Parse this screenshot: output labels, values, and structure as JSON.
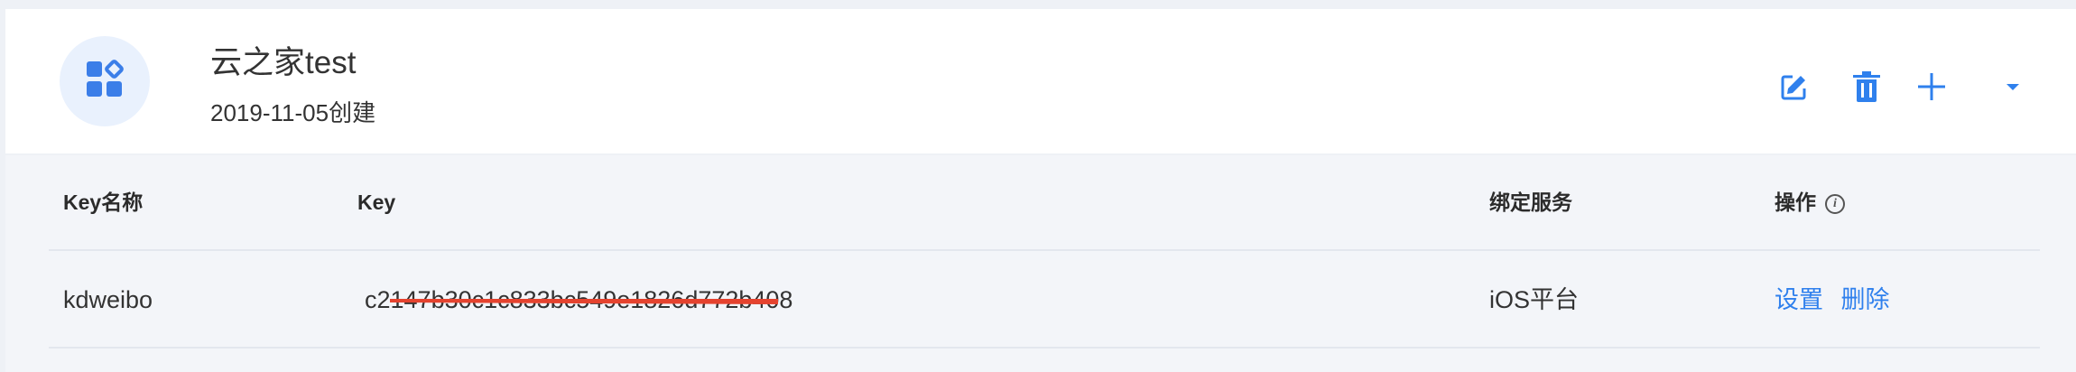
{
  "app": {
    "icon": "apps-grid-icon",
    "title": "云之家test",
    "created": "2019-11-05创建"
  },
  "actions": {
    "edit": "edit-icon",
    "delete": "trash-icon",
    "add": "plus-icon",
    "expand": "caret-down-icon"
  },
  "table": {
    "columns": [
      "Key名称",
      "Key",
      "绑定服务",
      "操作"
    ],
    "rows": [
      {
        "name": "kdweibo",
        "key": "c2147b30c1c833bc549e1826d772b408",
        "service": "iOS平台",
        "ops": [
          "设置",
          "删除"
        ]
      }
    ]
  },
  "colors": {
    "accent": "#2f80ed",
    "redaction": "#e5432f"
  }
}
